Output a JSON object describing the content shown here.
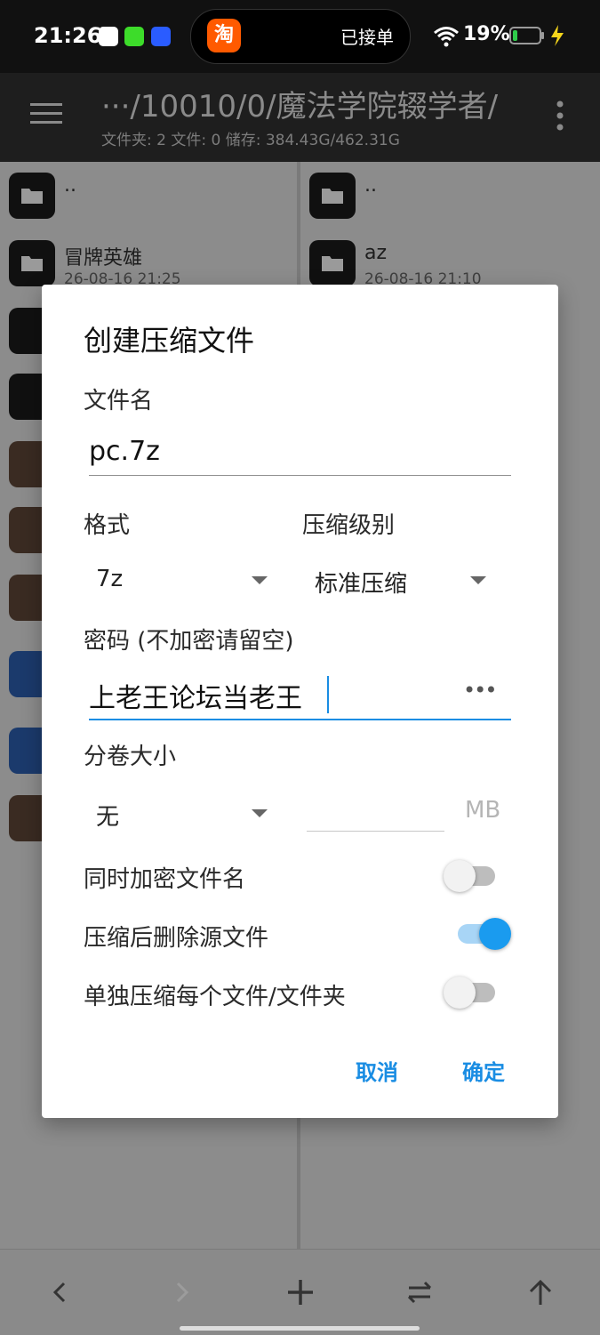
{
  "status_bar": {
    "time": "21:26",
    "pill_app_glyph": "淘",
    "pill_text": "已接单",
    "battery_percent": "19%",
    "battery_level": 0.19
  },
  "app_bar": {
    "path": "···/10010/0/魔法学院辍学者/",
    "stats": "文件夹: 2  文件: 0  储存: 384.43G/462.31G"
  },
  "left_pane": {
    "items": [
      {
        "name": "..",
        "date": "",
        "type": "folder"
      },
      {
        "name": "冒牌英雄",
        "date": "26-08-16 21:25",
        "type": "folder"
      }
    ]
  },
  "right_pane": {
    "items": [
      {
        "name": "..",
        "date": "",
        "type": "folder"
      },
      {
        "name": "az",
        "date": "26-08-16 21:10",
        "type": "folder"
      }
    ]
  },
  "dialog": {
    "title": "创建压缩文件",
    "filename_label": "文件名",
    "filename_value": "pc.7z",
    "format_label": "格式",
    "format_value": "7z",
    "level_label": "压缩级别",
    "level_value": "标准压缩",
    "password_label": "密码 (不加密请留空)",
    "password_value": "上老王论坛当老王",
    "password_dots": "•••",
    "volume_label": "分卷大小",
    "volume_value": "无",
    "volume_unit": "MB",
    "toggles": [
      {
        "label": "同时加密文件名",
        "on": false
      },
      {
        "label": "压缩后删除源文件",
        "on": true
      },
      {
        "label": "单独压缩每个文件/文件夹",
        "on": false
      }
    ],
    "cancel": "取消",
    "confirm": "确定"
  }
}
